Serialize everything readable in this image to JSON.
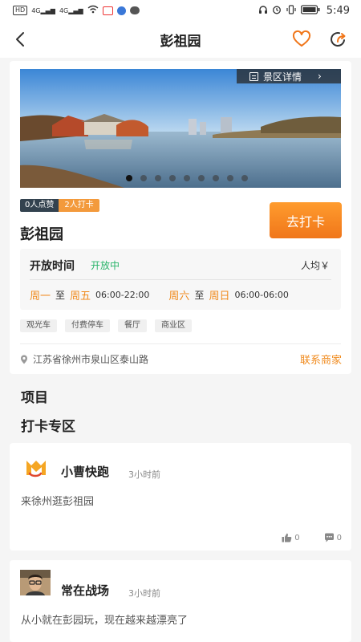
{
  "status_bar": {
    "network_badge": "HD",
    "signal_1": "4G",
    "signal_2": "4G",
    "time": "5:49"
  },
  "nav": {
    "title": "彭祖园"
  },
  "spot": {
    "detail_button": "景区详情",
    "like_count": "0人点赞",
    "checkin_count": "2人打卡",
    "name": "彭祖园",
    "checkin_button": "去打卡",
    "carousel_total": 9,
    "carousel_active": 1
  },
  "hours": {
    "label": "开放时间",
    "status": "开放中",
    "avg_price": "人均￥",
    "weekday_from": "周一",
    "weekday_to_word": "至",
    "weekday_to": "周五",
    "weekday_time": "06:00-22:00",
    "weekend_from": "周六",
    "weekend_to_word": "至",
    "weekend_to": "周日",
    "weekend_time": "06:00-06:00"
  },
  "facilities": [
    "观光车",
    "付费停车",
    "餐厅",
    "商业区"
  ],
  "address": {
    "text": "江苏省徐州市泉山区泰山路",
    "contact_link": "联系商家"
  },
  "sections": {
    "items": "项目",
    "checkin_zone": "打卡专区"
  },
  "posts": [
    {
      "user": "小曹快跑",
      "time": "3小时前",
      "text": "来徐州逛彭祖园",
      "likes": "0",
      "comments": "0"
    },
    {
      "user": "常在战场",
      "time": "3小时前",
      "text": "从小就在彭园玩，现在越来越漂亮了"
    }
  ],
  "colors": {
    "accent": "#f08a1c",
    "open_status": "#2ab46a",
    "like_badge": "#33424f",
    "checkin_badge": "#f39a3c"
  },
  "icons": {
    "back": "chevron-left-icon",
    "favorite": "heart-outline-icon",
    "share": "share-icon",
    "location": "location-pin-icon",
    "like": "thumbs-up-icon",
    "comment": "comment-icon"
  }
}
